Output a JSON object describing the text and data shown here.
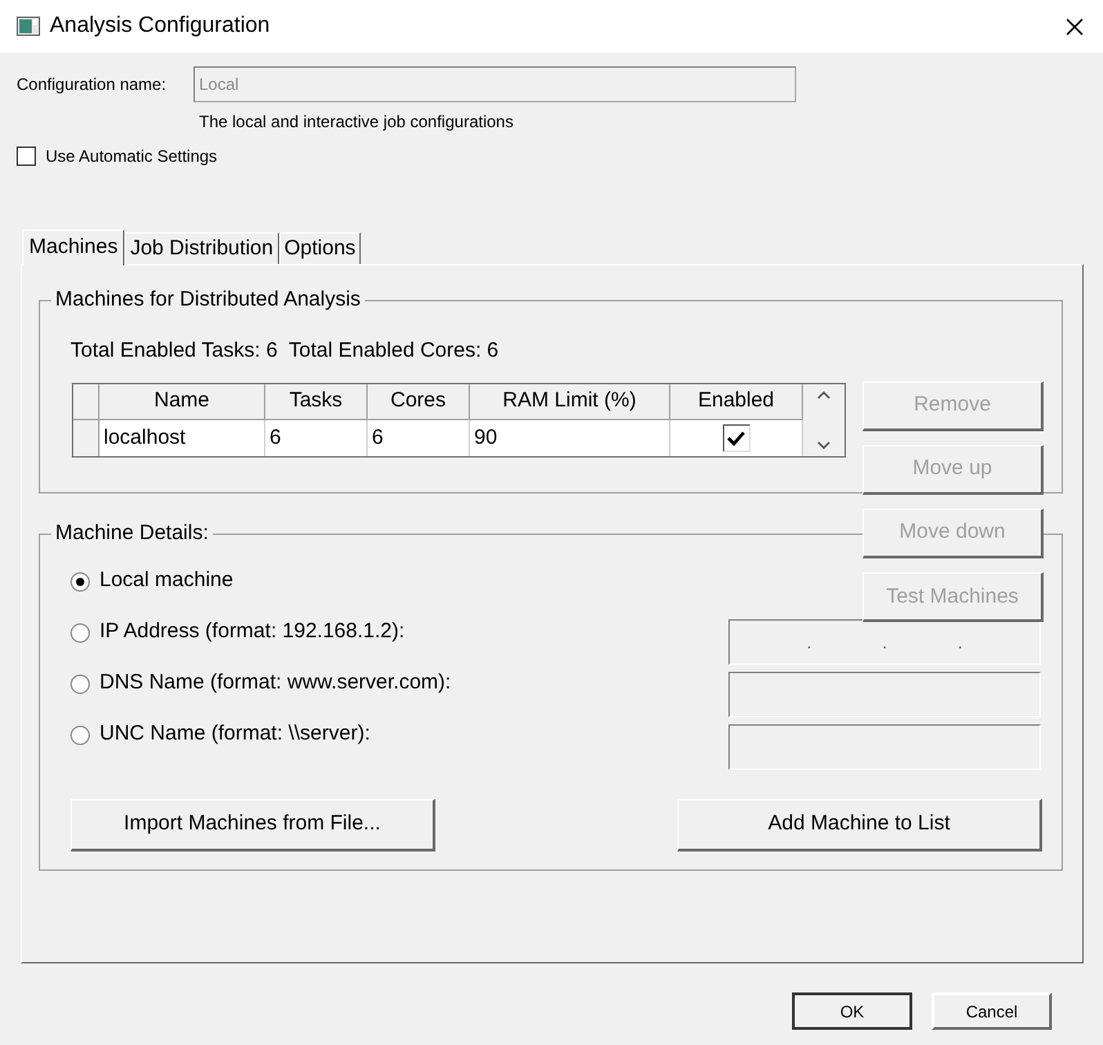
{
  "window": {
    "title": "Analysis Configuration"
  },
  "configuration_name": {
    "label": "Configuration name:",
    "value": "Local"
  },
  "description": "The local and interactive job configurations",
  "use_automatic_settings": {
    "label": "Use Automatic Settings",
    "checked": false
  },
  "tabs": [
    {
      "label": "Machines",
      "selected": true
    },
    {
      "label": "Job Distribution",
      "selected": false
    },
    {
      "label": "Options",
      "selected": false
    }
  ],
  "machines_group": {
    "title": "Machines for Distributed Analysis",
    "totals": "Total Enabled Tasks: 6  Total Enabled Cores: 6",
    "table": {
      "columns": [
        "Name",
        "Tasks",
        "Cores",
        "RAM Limit (%)",
        "Enabled"
      ],
      "rows": [
        {
          "cells": [
            "localhost",
            "6",
            "6",
            "90"
          ],
          "enabled": true
        }
      ]
    }
  },
  "side_buttons": [
    {
      "label": "Remove",
      "disabled": true
    },
    {
      "label": "Move up",
      "disabled": true
    },
    {
      "label": "Move down",
      "disabled": true
    },
    {
      "label": "Test Machines",
      "disabled": true
    }
  ],
  "details_group": {
    "title": "Machine Details:",
    "options": [
      {
        "label": "Local machine",
        "selected": true,
        "kind": "none"
      },
      {
        "label": "IP Address (format: 192.168.1.2):",
        "selected": false,
        "kind": "ip",
        "separators": [
          ".",
          ".",
          "."
        ]
      },
      {
        "label": "DNS Name (format: www.server.com):",
        "selected": false,
        "kind": "text"
      },
      {
        "label": "UNC Name (format: \\\\server):",
        "selected": false,
        "kind": "text"
      }
    ],
    "buttons": [
      "Import Machines from File...",
      "Add Machine to List"
    ]
  },
  "dialog_buttons": [
    {
      "label": "OK",
      "default": true
    },
    {
      "label": "Cancel",
      "default": false
    }
  ]
}
